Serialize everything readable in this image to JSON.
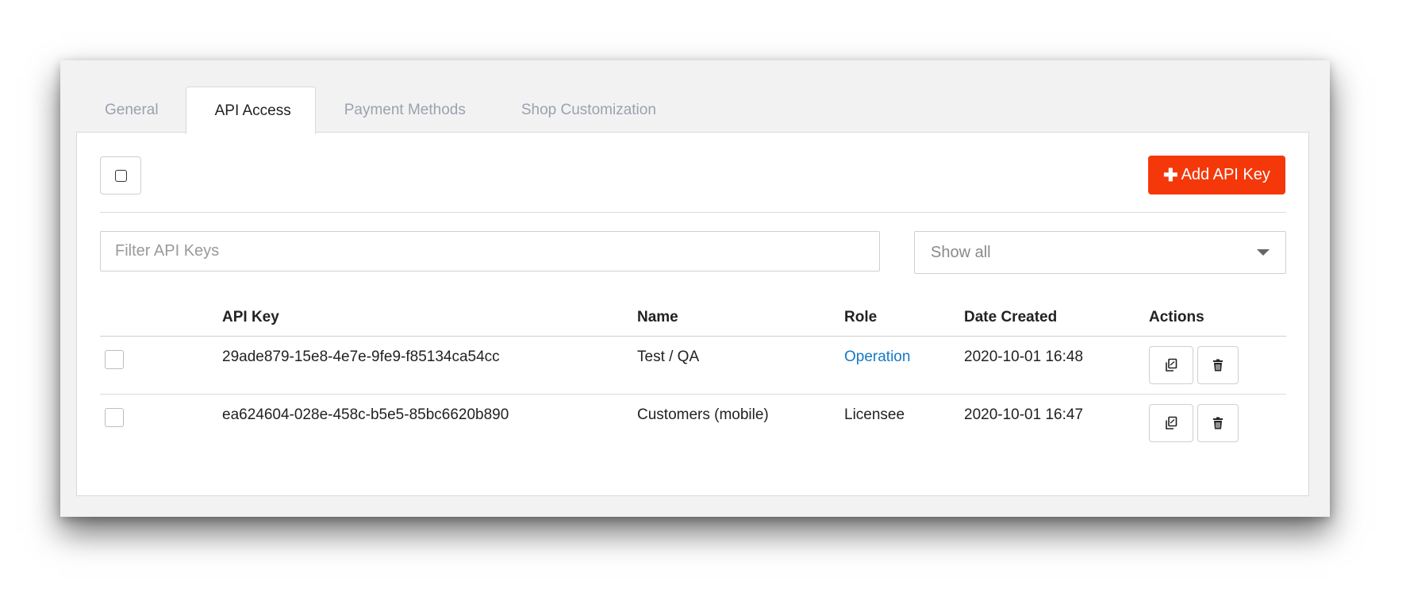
{
  "tabs": [
    {
      "label": "General",
      "active": false
    },
    {
      "label": "API Access",
      "active": true
    },
    {
      "label": "Payment Methods",
      "active": false
    },
    {
      "label": "Shop Customization",
      "active": false
    }
  ],
  "toolbar": {
    "add_button_label": "Add API Key",
    "add_button_icon": "plus-icon"
  },
  "filter": {
    "placeholder": "Filter API Keys",
    "value": ""
  },
  "role_select": {
    "value": "Show all"
  },
  "table": {
    "headers": {
      "api_key": "API Key",
      "name": "Name",
      "role": "Role",
      "date_created": "Date Created",
      "actions": "Actions"
    },
    "rows": [
      {
        "api_key": "29ade879-15e8-4e7e-9fe9-f85134ca54cc",
        "name": "Test / QA",
        "role": "Operation",
        "role_is_link": true,
        "date_created": "2020-10-01 16:48"
      },
      {
        "api_key": "ea624604-028e-458c-b5e5-85bc6620b890",
        "name": "Customers (mobile)",
        "role": "Licensee",
        "role_is_link": false,
        "date_created": "2020-10-01 16:47"
      }
    ]
  },
  "colors": {
    "accent": "#f5380a",
    "link": "#1479c6"
  },
  "icons": {
    "copy": "copy-icon",
    "delete": "trash-icon"
  }
}
